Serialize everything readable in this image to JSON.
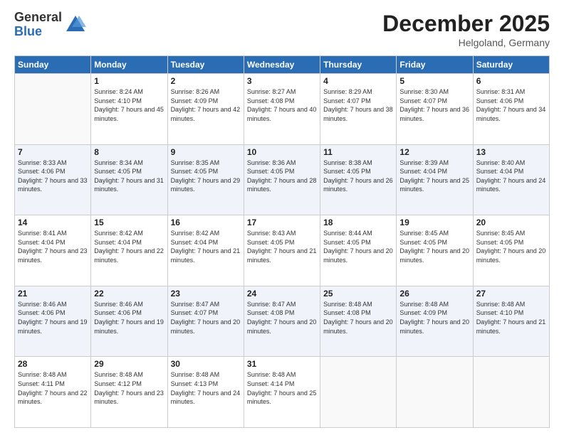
{
  "logo": {
    "general": "General",
    "blue": "Blue"
  },
  "header": {
    "month": "December 2025",
    "location": "Helgoland, Germany"
  },
  "weekdays": [
    "Sunday",
    "Monday",
    "Tuesday",
    "Wednesday",
    "Thursday",
    "Friday",
    "Saturday"
  ],
  "weeks": [
    [
      {
        "day": "",
        "sunrise": "",
        "sunset": "",
        "daylight": ""
      },
      {
        "day": "1",
        "sunrise": "8:24 AM",
        "sunset": "4:10 PM",
        "daylight": "7 hours and 45 minutes."
      },
      {
        "day": "2",
        "sunrise": "8:26 AM",
        "sunset": "4:09 PM",
        "daylight": "7 hours and 42 minutes."
      },
      {
        "day": "3",
        "sunrise": "8:27 AM",
        "sunset": "4:08 PM",
        "daylight": "7 hours and 40 minutes."
      },
      {
        "day": "4",
        "sunrise": "8:29 AM",
        "sunset": "4:07 PM",
        "daylight": "7 hours and 38 minutes."
      },
      {
        "day": "5",
        "sunrise": "8:30 AM",
        "sunset": "4:07 PM",
        "daylight": "7 hours and 36 minutes."
      },
      {
        "day": "6",
        "sunrise": "8:31 AM",
        "sunset": "4:06 PM",
        "daylight": "7 hours and 34 minutes."
      }
    ],
    [
      {
        "day": "7",
        "sunrise": "8:33 AM",
        "sunset": "4:06 PM",
        "daylight": "7 hours and 33 minutes."
      },
      {
        "day": "8",
        "sunrise": "8:34 AM",
        "sunset": "4:05 PM",
        "daylight": "7 hours and 31 minutes."
      },
      {
        "day": "9",
        "sunrise": "8:35 AM",
        "sunset": "4:05 PM",
        "daylight": "7 hours and 29 minutes."
      },
      {
        "day": "10",
        "sunrise": "8:36 AM",
        "sunset": "4:05 PM",
        "daylight": "7 hours and 28 minutes."
      },
      {
        "day": "11",
        "sunrise": "8:38 AM",
        "sunset": "4:05 PM",
        "daylight": "7 hours and 26 minutes."
      },
      {
        "day": "12",
        "sunrise": "8:39 AM",
        "sunset": "4:04 PM",
        "daylight": "7 hours and 25 minutes."
      },
      {
        "day": "13",
        "sunrise": "8:40 AM",
        "sunset": "4:04 PM",
        "daylight": "7 hours and 24 minutes."
      }
    ],
    [
      {
        "day": "14",
        "sunrise": "8:41 AM",
        "sunset": "4:04 PM",
        "daylight": "7 hours and 23 minutes."
      },
      {
        "day": "15",
        "sunrise": "8:42 AM",
        "sunset": "4:04 PM",
        "daylight": "7 hours and 22 minutes."
      },
      {
        "day": "16",
        "sunrise": "8:42 AM",
        "sunset": "4:04 PM",
        "daylight": "7 hours and 21 minutes."
      },
      {
        "day": "17",
        "sunrise": "8:43 AM",
        "sunset": "4:05 PM",
        "daylight": "7 hours and 21 minutes."
      },
      {
        "day": "18",
        "sunrise": "8:44 AM",
        "sunset": "4:05 PM",
        "daylight": "7 hours and 20 minutes."
      },
      {
        "day": "19",
        "sunrise": "8:45 AM",
        "sunset": "4:05 PM",
        "daylight": "7 hours and 20 minutes."
      },
      {
        "day": "20",
        "sunrise": "8:45 AM",
        "sunset": "4:05 PM",
        "daylight": "7 hours and 20 minutes."
      }
    ],
    [
      {
        "day": "21",
        "sunrise": "8:46 AM",
        "sunset": "4:06 PM",
        "daylight": "7 hours and 19 minutes."
      },
      {
        "day": "22",
        "sunrise": "8:46 AM",
        "sunset": "4:06 PM",
        "daylight": "7 hours and 19 minutes."
      },
      {
        "day": "23",
        "sunrise": "8:47 AM",
        "sunset": "4:07 PM",
        "daylight": "7 hours and 20 minutes."
      },
      {
        "day": "24",
        "sunrise": "8:47 AM",
        "sunset": "4:08 PM",
        "daylight": "7 hours and 20 minutes."
      },
      {
        "day": "25",
        "sunrise": "8:48 AM",
        "sunset": "4:08 PM",
        "daylight": "7 hours and 20 minutes."
      },
      {
        "day": "26",
        "sunrise": "8:48 AM",
        "sunset": "4:09 PM",
        "daylight": "7 hours and 20 minutes."
      },
      {
        "day": "27",
        "sunrise": "8:48 AM",
        "sunset": "4:10 PM",
        "daylight": "7 hours and 21 minutes."
      }
    ],
    [
      {
        "day": "28",
        "sunrise": "8:48 AM",
        "sunset": "4:11 PM",
        "daylight": "7 hours and 22 minutes."
      },
      {
        "day": "29",
        "sunrise": "8:48 AM",
        "sunset": "4:12 PM",
        "daylight": "7 hours and 23 minutes."
      },
      {
        "day": "30",
        "sunrise": "8:48 AM",
        "sunset": "4:13 PM",
        "daylight": "7 hours and 24 minutes."
      },
      {
        "day": "31",
        "sunrise": "8:48 AM",
        "sunset": "4:14 PM",
        "daylight": "7 hours and 25 minutes."
      },
      {
        "day": "",
        "sunrise": "",
        "sunset": "",
        "daylight": ""
      },
      {
        "day": "",
        "sunrise": "",
        "sunset": "",
        "daylight": ""
      },
      {
        "day": "",
        "sunrise": "",
        "sunset": "",
        "daylight": ""
      }
    ]
  ]
}
